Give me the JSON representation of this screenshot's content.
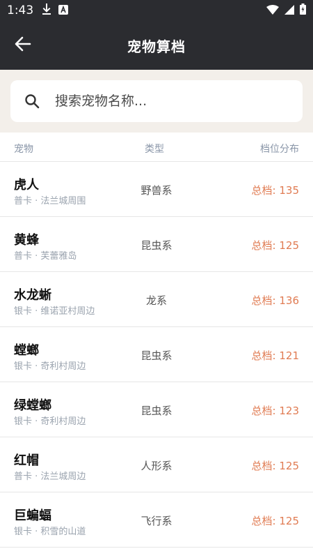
{
  "status_bar": {
    "time": "1:43",
    "icons_left": [
      "download-icon",
      "a-icon"
    ],
    "icons_right": [
      "wifi-icon",
      "signal-icon",
      "battery-icon"
    ]
  },
  "app_bar": {
    "title": "宠物算档",
    "back_icon": "arrow-left-icon"
  },
  "search": {
    "placeholder": "搜索宠物名称..."
  },
  "table": {
    "headers": {
      "pet": "宠物",
      "type": "类型",
      "distribution": "档位分布"
    },
    "rows": [
      {
        "name": "虎人",
        "sub": "普卡 · 法兰城周围",
        "type": "野兽系",
        "total": "总档: 135"
      },
      {
        "name": "黄蜂",
        "sub": "普卡 · 芙蕾雅岛",
        "type": "昆虫系",
        "total": "总档: 125"
      },
      {
        "name": "水龙蜥",
        "sub": "银卡 · 维诺亚村周边",
        "type": "龙系",
        "total": "总档: 136"
      },
      {
        "name": "螳螂",
        "sub": "银卡 · 奇利村周边",
        "type": "昆虫系",
        "total": "总档: 121"
      },
      {
        "name": "绿螳螂",
        "sub": "银卡 · 奇利村周边",
        "type": "昆虫系",
        "total": "总档: 123"
      },
      {
        "name": "红帽",
        "sub": "普卡 · 法兰城周边",
        "type": "人形系",
        "total": "总档: 125"
      },
      {
        "name": "巨蝙蝠",
        "sub": "银卡 · 积雪的山道",
        "type": "飞行系",
        "total": "总档: 125"
      }
    ]
  },
  "colors": {
    "appbar_bg": "#2b2c30",
    "search_bg": "#f3efea",
    "accent_total": "#e07b52",
    "header_text": "#8a96a8"
  }
}
